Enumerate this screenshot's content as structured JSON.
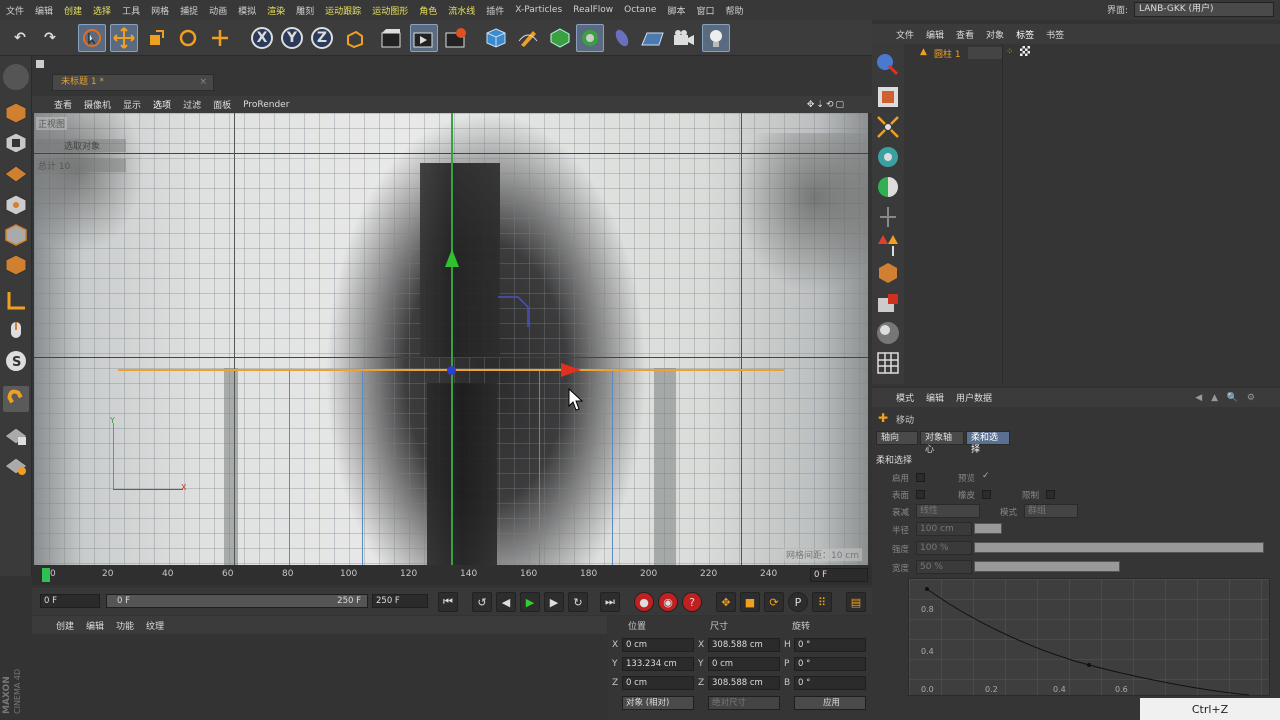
{
  "menubar": {
    "items": [
      "文件",
      "编辑",
      "创建",
      "选择",
      "工具",
      "网格",
      "捕捉",
      "动画",
      "模拟",
      "渲染",
      "雕刻",
      "运动跟踪",
      "运动图形",
      "角色",
      "流水线",
      "插件",
      "X-Particles",
      "RealFlow",
      "Octane",
      "脚本",
      "窗口",
      "帮助"
    ],
    "interface_label": "界面:",
    "interface_value": "LANB-GKK (用户)"
  },
  "toolbar": {
    "x_label": "X",
    "y_label": "Y",
    "z_label": "Z"
  },
  "document": {
    "tab_title": "未标题 1 *",
    "close_icon": "×"
  },
  "viewport": {
    "menu": [
      "查看",
      "摄像机",
      "显示",
      "选项",
      "过滤",
      "面板",
      "ProRender"
    ],
    "view_name": "正视图",
    "selected_label": "选取对象",
    "total_label": "总计 10",
    "grid_spacing": "网格间距：10 cm",
    "axis_y": "Y",
    "axis_x": "X"
  },
  "timeline": {
    "ticks": [
      "0",
      "20",
      "40",
      "60",
      "80",
      "100",
      "120",
      "140",
      "160",
      "180",
      "200",
      "220",
      "240"
    ],
    "current_frame": "0 F"
  },
  "transport": {
    "start": "0 F",
    "range_start": "0 F",
    "range_end": "250 F",
    "end": "250 F"
  },
  "material_manager": {
    "menu": [
      "创建",
      "编辑",
      "功能",
      "纹理"
    ]
  },
  "brand": {
    "maxon": "MAXON",
    "c4d": "CINEMA 4D"
  },
  "coordinates": {
    "headers": [
      "位置",
      "尺寸",
      "旋转"
    ],
    "rows": [
      {
        "pl": "X",
        "pv": "0 cm",
        "sl": "X",
        "sv": "308.588 cm",
        "rl": "H",
        "rv": "0 °"
      },
      {
        "pl": "Y",
        "pv": "133.234 cm",
        "sl": "Y",
        "sv": "0 cm",
        "rl": "P",
        "rv": "0 °"
      },
      {
        "pl": "Z",
        "pv": "0 cm",
        "sl": "Z",
        "sv": "308.588 cm",
        "rl": "B",
        "rv": "0 °"
      }
    ],
    "mode": "对象 (相对)",
    "size_mode": "绝对尺寸",
    "apply": "应用"
  },
  "object_manager": {
    "menu": [
      "文件",
      "编辑",
      "查看",
      "对象",
      "标签",
      "书签"
    ],
    "object_name": "圆柱 1"
  },
  "attributes": {
    "menu": [
      "模式",
      "编辑",
      "用户数据"
    ],
    "tool_name": "移动",
    "tabs": [
      "轴向",
      "对象轴心",
      "柔和选择"
    ],
    "section": "柔和选择",
    "enable": "启用",
    "preview": "预览",
    "surface": "表面",
    "rubber": "橡皮",
    "limit": "限制",
    "falloff_label": "衰减",
    "falloff_value": "线性",
    "mode_label": "模式",
    "mode_value": "群组",
    "radius_label": "半径",
    "radius_value": "100 cm",
    "strength_label": "强度",
    "strength_value": "100 %",
    "width_label": "宽度",
    "width_value": "50 %",
    "graph_y": [
      "0.8",
      "0.4",
      "0.0"
    ],
    "graph_x": [
      "0.2",
      "0.4",
      "0.6"
    ]
  },
  "overlay": {
    "shortcut": "Ctrl+Z"
  }
}
